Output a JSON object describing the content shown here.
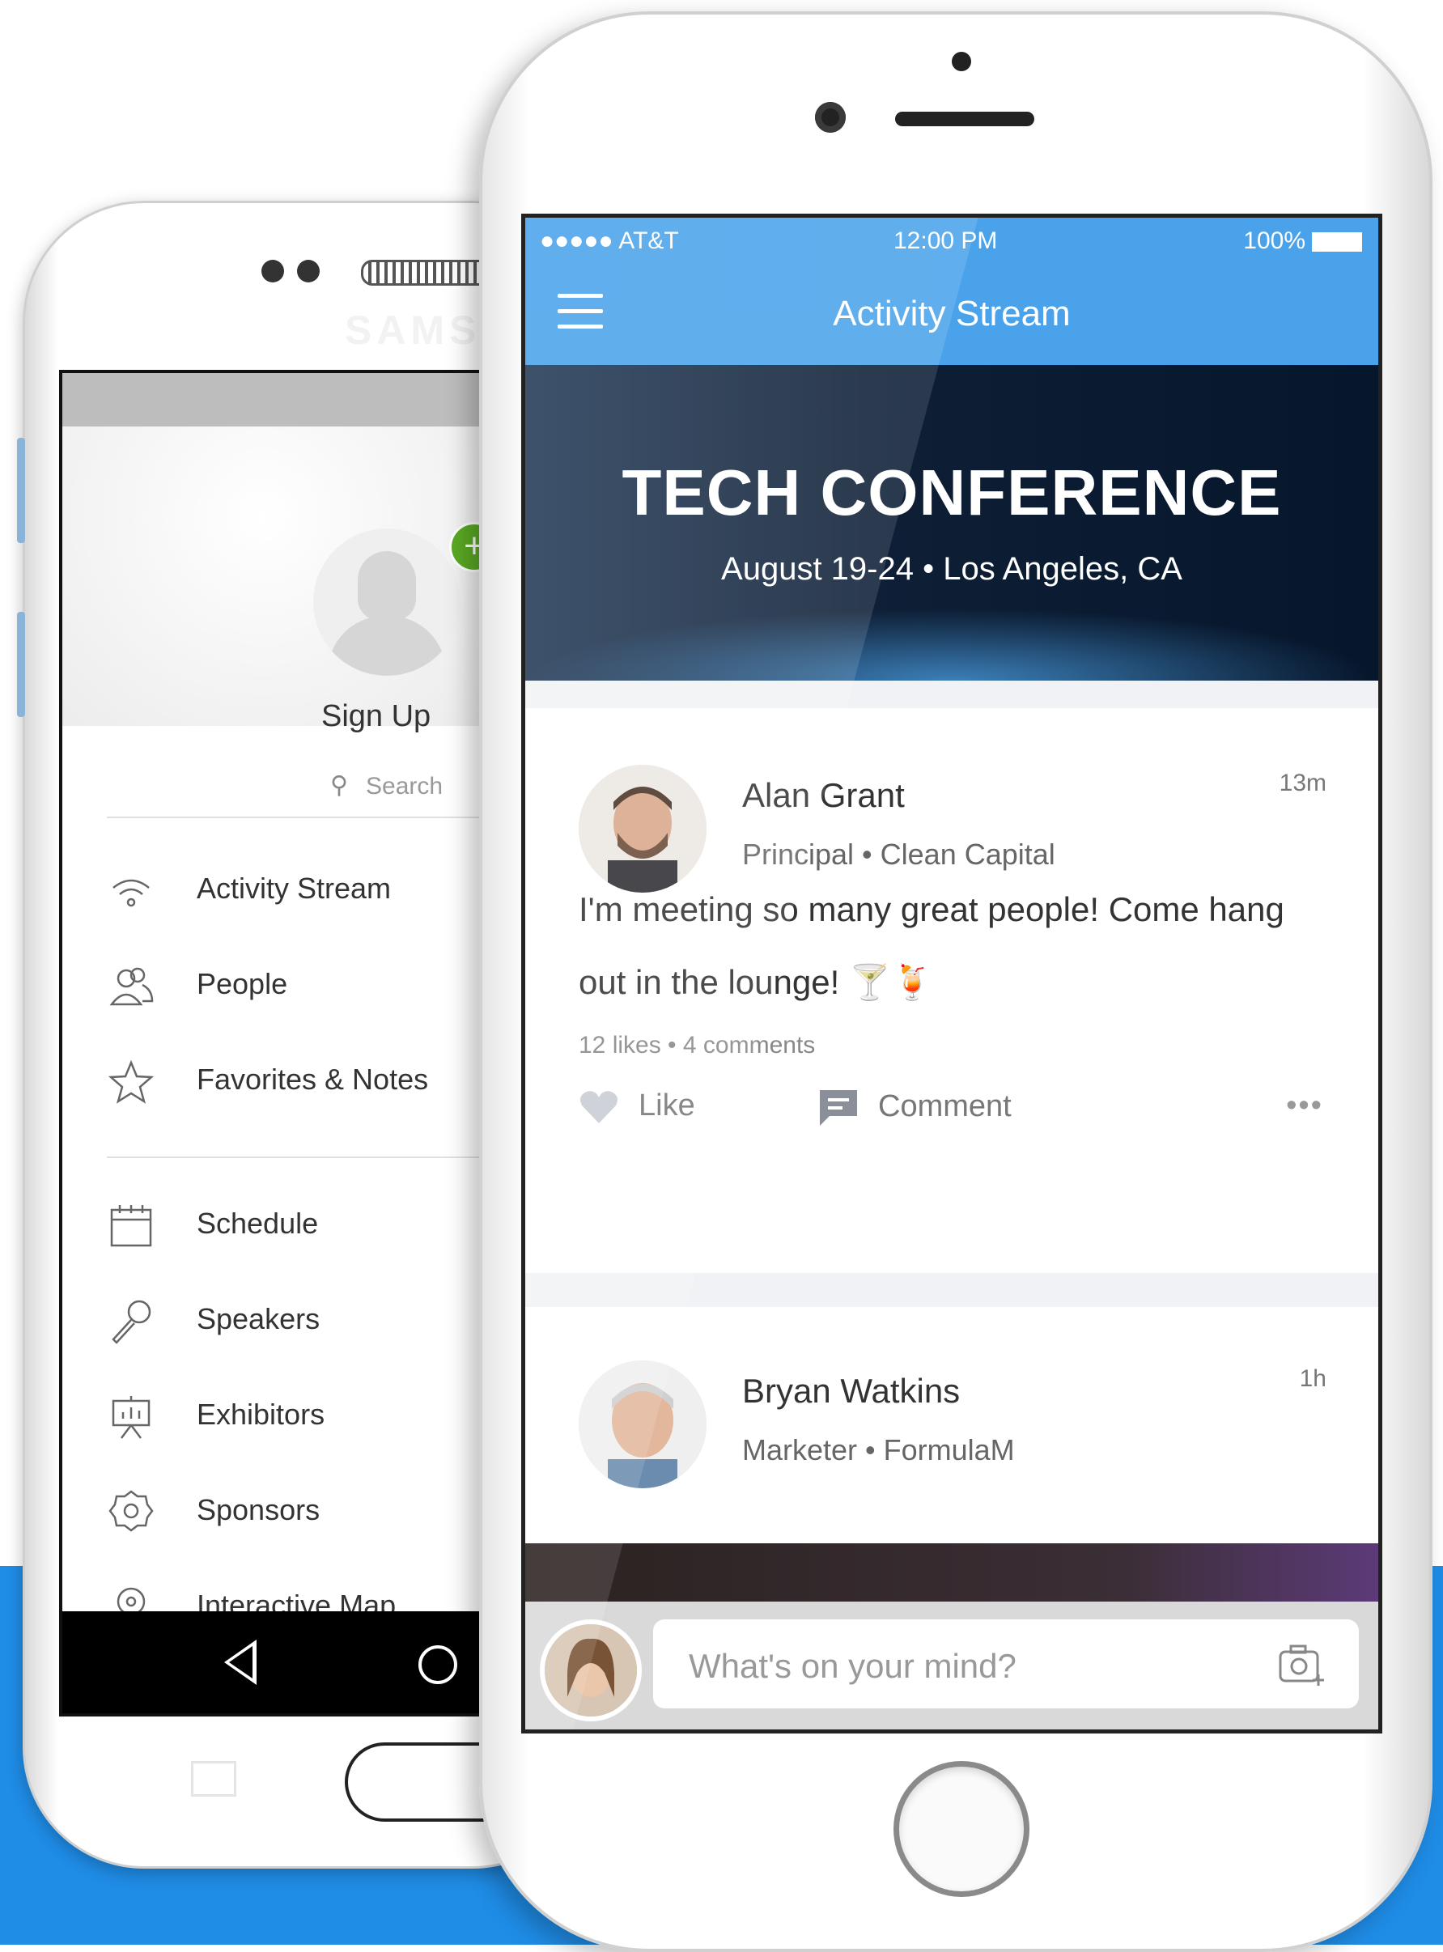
{
  "android": {
    "profile": {
      "signup_label": "Sign Up"
    },
    "search": {
      "placeholder": "Search"
    },
    "menu": [
      {
        "label": "Activity Stream",
        "icon": "wifi-icon"
      },
      {
        "label": "People",
        "icon": "people-icon"
      },
      {
        "label": "Favorites & Notes",
        "icon": "star-icon"
      },
      {
        "label": "Schedule",
        "icon": "calendar-icon"
      },
      {
        "label": "Speakers",
        "icon": "microphone-icon"
      },
      {
        "label": "Exhibitors",
        "icon": "easel-icon"
      },
      {
        "label": "Sponsors",
        "icon": "badge-icon"
      },
      {
        "label": "Interactive Map",
        "icon": "map-pin-icon"
      }
    ]
  },
  "iphone": {
    "status": {
      "carrier": "●●●●● AT&T",
      "time": "12:00 PM",
      "battery": "100%"
    },
    "header": {
      "title": "Activity Stream"
    },
    "banner": {
      "title": "TECH CONFERENCE",
      "subtitle": "August 19-24 • Los Angeles, CA"
    },
    "posts": [
      {
        "author": "Alan Grant",
        "role": "Principal  •  Clean Capital",
        "time_ago": "13m",
        "body": "I'm meeting so many great people! Come hang out in the lounge! 🍸🍹",
        "stats": "12 likes  •  4 comments",
        "like_label": "Like",
        "comment_label": "Comment",
        "more_label": "•••"
      },
      {
        "author": "Bryan Watkins",
        "role": "Marketer  •  FormulaM",
        "time_ago": "1h"
      }
    ],
    "composer": {
      "placeholder": "What's on your mind?"
    }
  },
  "colors": {
    "accent": "#4aa3ea",
    "background_blue": "#1f8ce6",
    "add_badge": "#5aa923"
  }
}
